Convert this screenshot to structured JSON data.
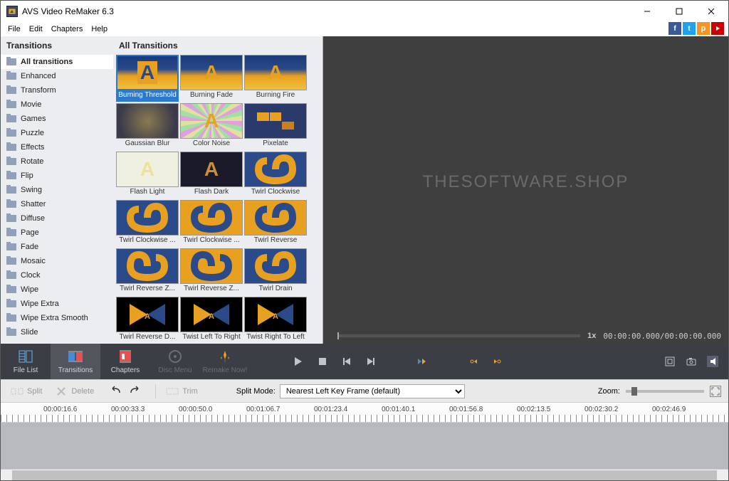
{
  "window": {
    "title": "AVS Video ReMaker 6.3",
    "minimize": "—",
    "maximize": "□",
    "close": "✕"
  },
  "menubar": [
    "File",
    "Edit",
    "Chapters",
    "Help"
  ],
  "social": {
    "fb": "f",
    "tw": "t",
    "pin": "p",
    "yt": "▶"
  },
  "left_panel": {
    "title": "Transitions",
    "items": [
      "All transitions",
      "Enhanced",
      "Transform",
      "Movie",
      "Games",
      "Puzzle",
      "Effects",
      "Rotate",
      "Flip",
      "Swing",
      "Shatter",
      "Diffuse",
      "Page",
      "Fade",
      "Mosaic",
      "Clock",
      "Wipe",
      "Wipe Extra",
      "Wipe Extra Smooth",
      "Slide"
    ],
    "selected": 0
  },
  "mid_panel": {
    "title": "All Transitions",
    "items": [
      "Burning Threshold",
      "Burning Fade",
      "Burning Fire",
      "Gaussian Blur",
      "Color Noise",
      "Pixelate",
      "Flash Light",
      "Flash Dark",
      "Twirl Clockwise",
      "Twirl Clockwise ...",
      "Twirl Clockwise ...",
      "Twirl Reverse",
      "Twirl Reverse Z...",
      "Twirl Reverse Z...",
      "Twirl Drain",
      "Twirl Reverse D...",
      "Twist Left To Right",
      "Twist Right To Left"
    ],
    "selected": 0
  },
  "preview": {
    "watermark": "THESOFTWARE.SHOP",
    "speed": "1x",
    "time_current": "00:00:00.000",
    "time_sep": " / ",
    "time_total": "00:00:00.000"
  },
  "toolbar": {
    "tabs": [
      {
        "label": "File List",
        "active": false,
        "disabled": false
      },
      {
        "label": "Transitions",
        "active": true,
        "disabled": false
      },
      {
        "label": "Chapters",
        "active": false,
        "disabled": false
      },
      {
        "label": "Disc Menu",
        "active": false,
        "disabled": true
      },
      {
        "label": "Remake Now!",
        "active": false,
        "disabled": true
      }
    ]
  },
  "edit_row": {
    "split": "Split",
    "delete": "Delete",
    "trim": "Trim",
    "split_mode_label": "Split Mode:",
    "split_mode_value": "Nearest Left Key Frame (default)",
    "zoom_label": "Zoom:"
  },
  "timeline": {
    "ticks": [
      "00:00:16.6",
      "00:00:33.3",
      "00:00:50.0",
      "00:01:06.7",
      "00:01:23.4",
      "00:01:40.1",
      "00:01:56.8",
      "00:02:13.5",
      "00:02:30.2",
      "00:02:46.9"
    ]
  }
}
